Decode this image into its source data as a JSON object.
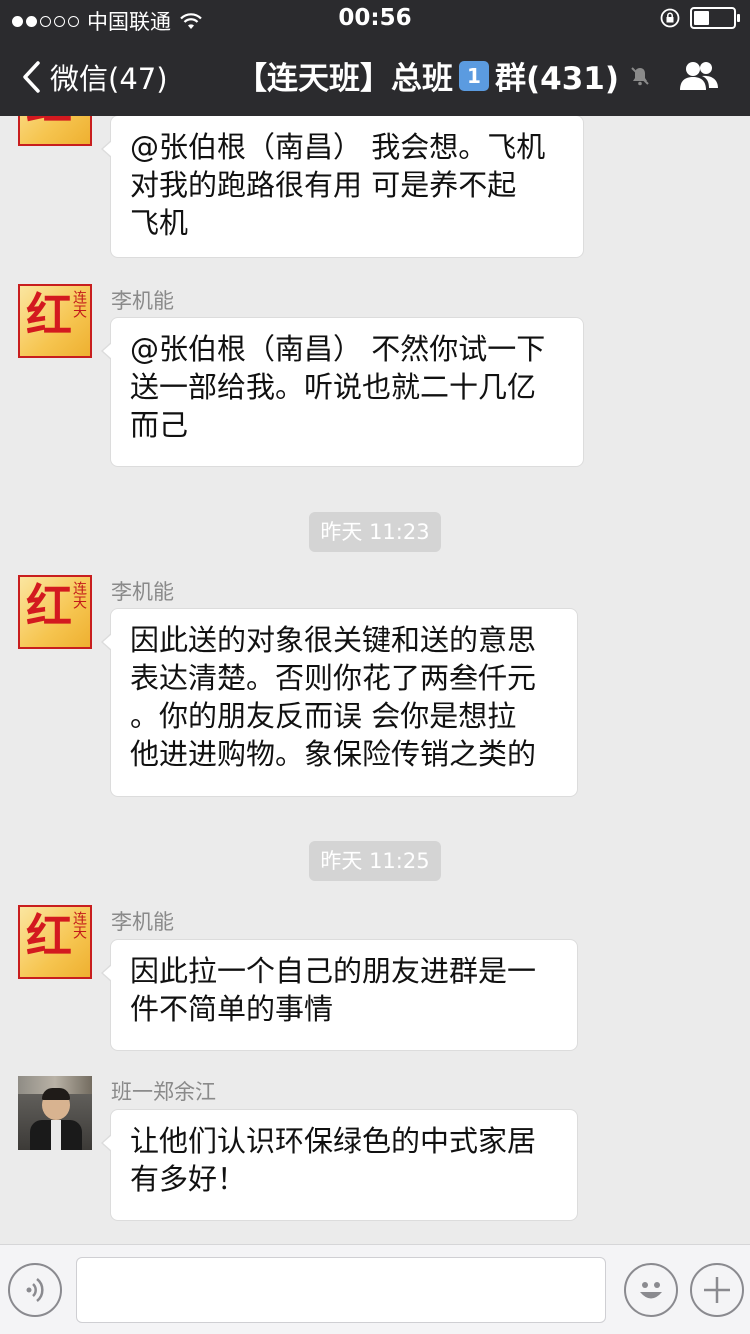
{
  "status_bar": {
    "carrier": "中国联通",
    "time": "00:56"
  },
  "nav": {
    "back_label": "微信(47)",
    "title_prefix": "【连天班】总班",
    "title_badge": "1",
    "title_suffix": "群(431)"
  },
  "messages": [
    {
      "sender": "",
      "text": "@张伯根（南昌） 我会想。飞机\n对我的跑路很有用  可是养不起\n飞机"
    },
    {
      "sender": "李机能",
      "text": "@张伯根（南昌） 不然你试一下\n送一部给我。听说也就二十几亿\n而己"
    },
    {
      "sender": "李机能",
      "text": "因此送的对象很关键和送的意思\n表达清楚。否则你花了两叁仟元\n。你的朋友反而误  会你是想拉\n他进进购物。象保险传销之类的"
    },
    {
      "sender": "李机能",
      "text": "因此拉一个自己的朋友进群是一\n件不简单的事情"
    },
    {
      "sender": "班一郑余江",
      "text": "让他们认识环保绿色的中式家居\n有多好！"
    }
  ],
  "timestamps": [
    "昨天 11:23",
    "昨天 11:25"
  ],
  "avatar_text": {
    "big": "红",
    "small": "连天"
  },
  "colors": {
    "bar_bg": "#2b2b2e",
    "chat_bg": "#ebebeb",
    "timestamp_bg": "#d4d4d4",
    "avatar_red": "#d3191f"
  }
}
